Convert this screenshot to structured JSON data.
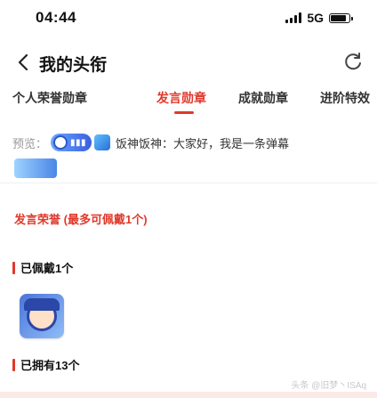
{
  "status_bar": {
    "time": "04:44",
    "network": "5G",
    "battery_level": 0.85
  },
  "nav": {
    "back_icon": "chevron-left-icon",
    "title": "我的头衔",
    "refresh_icon": "refresh-icon"
  },
  "tabs": [
    {
      "label": "个人荣誉勋章"
    },
    {
      "label": "发言勋章",
      "active": true
    },
    {
      "label": "成就勋章"
    },
    {
      "label": "进阶特效"
    }
  ],
  "preview": {
    "label": "预览：",
    "text": "饭神饭神：大家好，我是一条弹幕"
  },
  "section": {
    "title": "发言荣誉",
    "subtitle": "(最多可佩戴1个)"
  },
  "groups": [
    {
      "label": "已佩戴1个"
    },
    {
      "label": "已拥有13个"
    }
  ],
  "watermark": "头条 @旧梦丶ISAq",
  "colors": {
    "accent": "#e0392b",
    "text": "#111111",
    "muted": "#999999"
  }
}
